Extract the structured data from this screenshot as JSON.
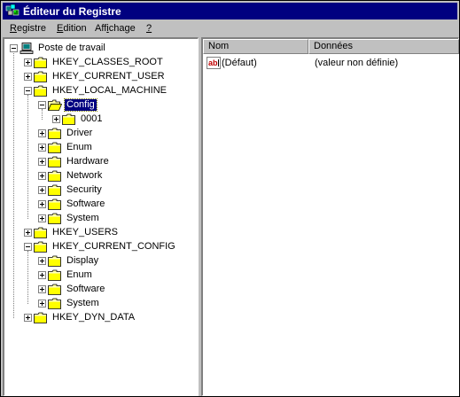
{
  "window": {
    "title": "Éditeur du Registre"
  },
  "menu": {
    "items": [
      {
        "label": "Registre",
        "underline": "R",
        "rest": "egistre"
      },
      {
        "label": "Edition",
        "underline": "E",
        "rest": "dition"
      },
      {
        "label": "Affichage",
        "pre": "Aff",
        "underline": "i",
        "rest": "chage"
      },
      {
        "label": "?",
        "underline": "?",
        "rest": ""
      }
    ]
  },
  "tree": {
    "nodes": [
      {
        "label": "Poste de travail",
        "depth": 0,
        "expander": "minus",
        "icon": "computer-icon"
      },
      {
        "label": "HKEY_CLASSES_ROOT",
        "depth": 1,
        "expander": "plus",
        "icon": "folder-icon"
      },
      {
        "label": "HKEY_CURRENT_USER",
        "depth": 1,
        "expander": "plus",
        "icon": "folder-icon"
      },
      {
        "label": "HKEY_LOCAL_MACHINE",
        "depth": 1,
        "expander": "minus",
        "icon": "folder-icon"
      },
      {
        "label": "Config",
        "depth": 2,
        "expander": "minus",
        "icon": "open-folder-icon",
        "selected": true
      },
      {
        "label": "0001",
        "depth": 3,
        "expander": "plus",
        "icon": "folder-icon"
      },
      {
        "label": "Driver",
        "depth": 2,
        "expander": "plus",
        "icon": "folder-icon"
      },
      {
        "label": "Enum",
        "depth": 2,
        "expander": "plus",
        "icon": "folder-icon"
      },
      {
        "label": "Hardware",
        "depth": 2,
        "expander": "plus",
        "icon": "folder-icon"
      },
      {
        "label": "Network",
        "depth": 2,
        "expander": "plus",
        "icon": "folder-icon"
      },
      {
        "label": "Security",
        "depth": 2,
        "expander": "plus",
        "icon": "folder-icon"
      },
      {
        "label": "Software",
        "depth": 2,
        "expander": "plus",
        "icon": "folder-icon"
      },
      {
        "label": "System",
        "depth": 2,
        "expander": "plus",
        "icon": "folder-icon"
      },
      {
        "label": "HKEY_USERS",
        "depth": 1,
        "expander": "plus",
        "icon": "folder-icon"
      },
      {
        "label": "HKEY_CURRENT_CONFIG",
        "depth": 1,
        "expander": "minus",
        "icon": "folder-icon"
      },
      {
        "label": "Display",
        "depth": 2,
        "expander": "plus",
        "icon": "folder-icon"
      },
      {
        "label": "Enum",
        "depth": 2,
        "expander": "plus",
        "icon": "folder-icon"
      },
      {
        "label": "Software",
        "depth": 2,
        "expander": "plus",
        "icon": "folder-icon"
      },
      {
        "label": "System",
        "depth": 2,
        "expander": "plus",
        "icon": "folder-icon"
      },
      {
        "label": "HKEY_DYN_DATA",
        "depth": 1,
        "expander": "plus",
        "icon": "folder-icon"
      }
    ]
  },
  "list": {
    "columns": [
      "Nom",
      "Données"
    ],
    "rows": [
      {
        "name": "(Défaut)",
        "data": "(valeur non définie)",
        "icon": "string-value-icon"
      }
    ]
  },
  "colors": {
    "titlebar": "#000080",
    "selection": "#000080",
    "window": "#c0c0c0"
  }
}
